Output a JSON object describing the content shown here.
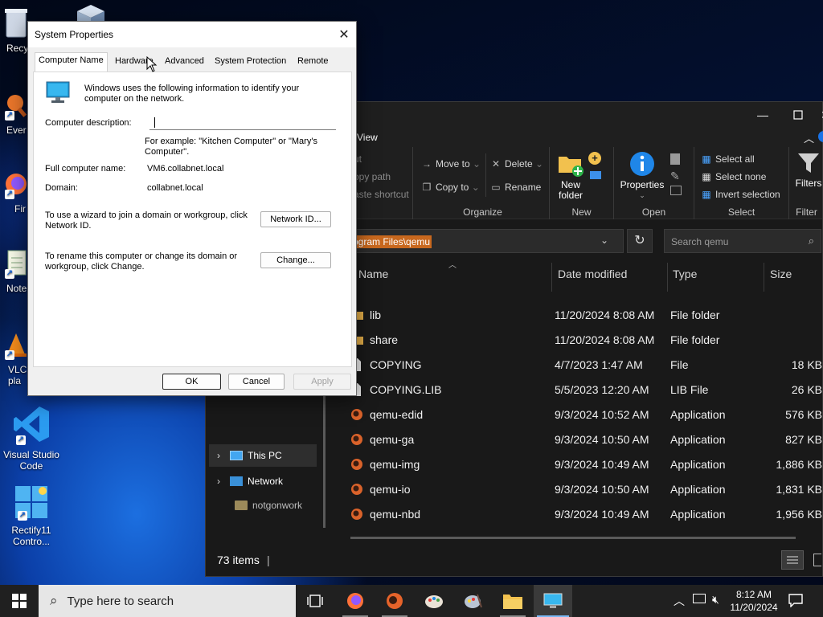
{
  "desktop": {
    "icons": [
      {
        "label": "Recy"
      },
      {
        "label": "Ever"
      },
      {
        "label": "Fir"
      },
      {
        "label": "Note"
      },
      {
        "label": "VLC\npla"
      },
      {
        "label": "Visual Studio\nCode"
      },
      {
        "label": "Rectify11\nContro..."
      }
    ]
  },
  "sysprops": {
    "title": "System Properties",
    "tabs": [
      "Computer Name",
      "Hardware",
      "Advanced",
      "System Protection",
      "Remote"
    ],
    "intro": "Windows uses the following information to identify your computer on the network.",
    "description_label": "Computer description:",
    "description_value": "",
    "example": "For example: \"Kitchen Computer\" or \"Mary's Computer\".",
    "full_name_label": "Full computer name:",
    "full_name_value": "VM6.collabnet.local",
    "domain_label": "Domain:",
    "domain_value": "collabnet.local",
    "wizard_text": "To use a wizard to join a domain or workgroup, click Network ID.",
    "network_id_button": "Network ID...",
    "rename_text": "To rename this computer or change its domain or workgroup, click Change.",
    "change_button": "Change...",
    "ok_button": "OK",
    "cancel_button": "Cancel",
    "apply_button": "Apply"
  },
  "explorer": {
    "tab_label": "View",
    "ribbon": {
      "clipboard": {
        "cut": "ut",
        "copy_path": "opy path",
        "paste_shortcut": "aste shortcut"
      },
      "organize": {
        "label": "Organize",
        "move_to": "Move to",
        "copy_to": "Copy to",
        "delete": "Delete",
        "rename": "Rename"
      },
      "new": {
        "label": "New",
        "new_folder": "New\nfolder"
      },
      "open": {
        "label": "Open",
        "properties": "Properties"
      },
      "select": {
        "label": "Select",
        "select_all": "Select all",
        "select_none": "Select none",
        "invert": "Invert selection"
      },
      "filter": {
        "label": "Filter",
        "filters": "Filters"
      }
    },
    "address": "ogram Files\\qemu",
    "search_placeholder": "Search qemu",
    "nav": [
      {
        "label": "notgonwork"
      },
      {
        "label": "This PC"
      },
      {
        "label": "Network"
      }
    ],
    "columns": [
      "Name",
      "Date modified",
      "Type",
      "Size"
    ],
    "rows": [
      {
        "name": "lib",
        "date": "11/20/2024 8:08 AM",
        "type": "File folder",
        "size": "",
        "icon": "folder-icon"
      },
      {
        "name": "share",
        "date": "11/20/2024 8:08 AM",
        "type": "File folder",
        "size": "",
        "icon": "folder-icon"
      },
      {
        "name": "COPYING",
        "date": "4/7/2023 1:47 AM",
        "type": "File",
        "size": "18 KB",
        "icon": "file-icon"
      },
      {
        "name": "COPYING.LIB",
        "date": "5/5/2023 12:20 AM",
        "type": "LIB File",
        "size": "26 KB",
        "icon": "file-icon"
      },
      {
        "name": "qemu-edid",
        "date": "9/3/2024 10:52 AM",
        "type": "Application",
        "size": "576 KB",
        "icon": "qemu-app-icon"
      },
      {
        "name": "qemu-ga",
        "date": "9/3/2024 10:50 AM",
        "type": "Application",
        "size": "827 KB",
        "icon": "qemu-app-icon"
      },
      {
        "name": "qemu-img",
        "date": "9/3/2024 10:49 AM",
        "type": "Application",
        "size": "1,886 KB",
        "icon": "qemu-app-icon"
      },
      {
        "name": "qemu-io",
        "date": "9/3/2024 10:50 AM",
        "type": "Application",
        "size": "1,831 KB",
        "icon": "qemu-app-icon"
      },
      {
        "name": "qemu-nbd",
        "date": "9/3/2024 10:49 AM",
        "type": "Application",
        "size": "1,956 KB",
        "icon": "qemu-app-icon"
      }
    ],
    "status": "73 items"
  },
  "taskbar": {
    "search_placeholder": "Type here to search",
    "time": "8:12 AM",
    "date": "11/20/2024"
  },
  "colors": {
    "address_highlight": "#c8681e",
    "accent": "#1664d8"
  }
}
